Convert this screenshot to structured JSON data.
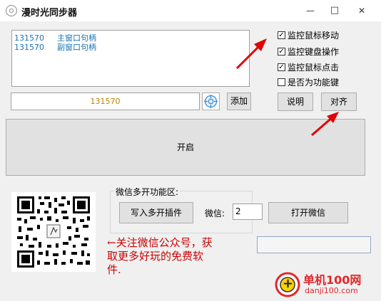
{
  "window": {
    "title": "漫时光同步器",
    "minimize_glyph": "—",
    "maximize_glyph": "□",
    "close_glyph": "✕"
  },
  "log": {
    "lines": [
      {
        "handle": "131570",
        "label": "主窗口句柄"
      },
      {
        "handle": "131570",
        "label": "副窗口句柄"
      }
    ]
  },
  "options": {
    "mouse_move": {
      "label": "监控鼠标移动",
      "checked": true
    },
    "keyboard": {
      "label": "监控键盘操作",
      "checked": true
    },
    "mouse_click": {
      "label": "监控鼠标点击",
      "checked": true
    },
    "function_key": {
      "label": "是否为功能键",
      "checked": false
    }
  },
  "handle_input": {
    "value": "131570"
  },
  "buttons": {
    "add": "添加",
    "help": "说明",
    "align": "对齐",
    "start": "开启",
    "write_plugin": "写入多开插件",
    "open_wechat": "打开微信"
  },
  "wechat_group": {
    "title": "微信多开功能区:",
    "count_label": "微信:",
    "count_value": "2"
  },
  "promo": {
    "line1": "←关注微信公众号，获",
    "line2": "取更多好玩的免费软",
    "line3": "件."
  },
  "watermark": {
    "name": "单机100网",
    "url": "danji100.com",
    "badge": "+"
  },
  "colors": {
    "log_text": "#1a73b5",
    "handle_text": "#c08000",
    "promo_text": "#cc0000",
    "arrow": "#e00000",
    "watermark_red": "#e4262b"
  },
  "icons": {
    "app": "app-icon",
    "crosshair": "crosshair-target-icon",
    "qr": "qr-code"
  }
}
